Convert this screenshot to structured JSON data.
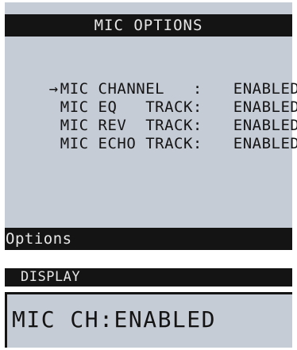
{
  "main_screen": {
    "title": "MIC OPTIONS",
    "cursor_glyph": "→",
    "items": [
      {
        "label": "MIC CHANNEL   :",
        "value": "ENABLED",
        "selected": true
      },
      {
        "label": "MIC EQ   TRACK:",
        "value": "ENABLED",
        "selected": false
      },
      {
        "label": "MIC REV  TRACK:",
        "value": "ENABLED",
        "selected": false
      },
      {
        "label": "MIC ECHO TRACK:",
        "value": "ENABLED",
        "selected": false
      }
    ],
    "footer": "Options"
  },
  "display": {
    "header": "DISPLAY",
    "text": "MIC CH:ENABLED"
  }
}
